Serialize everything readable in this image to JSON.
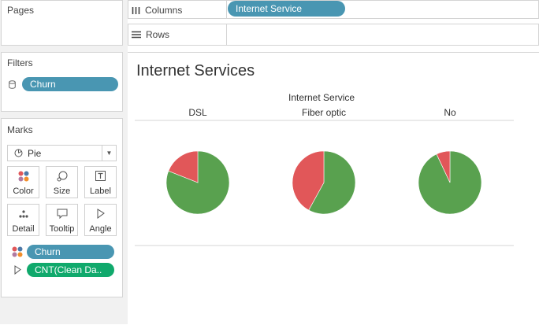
{
  "pages": {
    "title": "Pages"
  },
  "filters": {
    "title": "Filters",
    "pill": "Churn"
  },
  "marks": {
    "title": "Marks",
    "mark_type": "Pie",
    "buttons": {
      "color": "Color",
      "size": "Size",
      "label": "Label",
      "detail": "Detail",
      "tooltip": "Tooltip",
      "angle": "Angle"
    },
    "pills": {
      "churn": "Churn",
      "angle_field": "CNT(Clean Da.."
    }
  },
  "shelves": {
    "columns_label": "Columns",
    "columns_pill": "Internet Service",
    "rows_label": "Rows"
  },
  "view": {
    "title": "Internet Services",
    "column_header": "Internet Service"
  },
  "colors": {
    "no_churn": "#59a14f",
    "churn": "#e15759",
    "pill_blue": "#4996b2",
    "pill_green": "#10a96c"
  },
  "chart_data": {
    "type": "pie",
    "categories": [
      "DSL",
      "Fiber optic",
      "No"
    ],
    "series": [
      {
        "values": [
          81,
          58,
          93
        ]
      },
      {
        "values": [
          19,
          42,
          7
        ]
      }
    ]
  }
}
